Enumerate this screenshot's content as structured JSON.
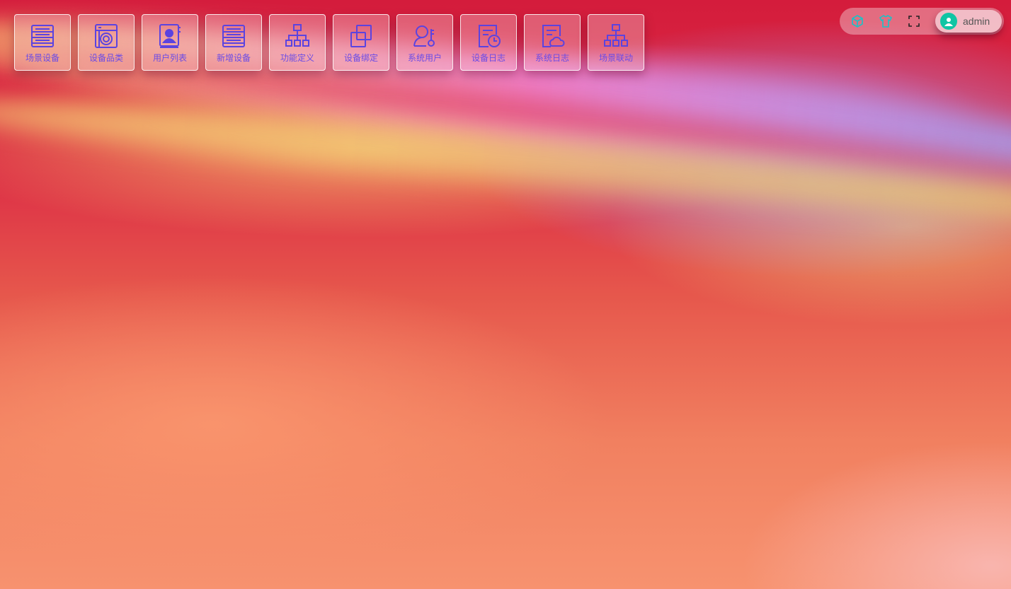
{
  "desktop": {
    "shortcuts": [
      {
        "label": "场景设备",
        "icon": "server-list-icon"
      },
      {
        "label": "设备品类",
        "icon": "washing-machine-icon"
      },
      {
        "label": "用户列表",
        "icon": "contact-book-icon"
      },
      {
        "label": "新增设备",
        "icon": "server-list-icon"
      },
      {
        "label": "功能定义",
        "icon": "org-chart-icon"
      },
      {
        "label": "设备绑定",
        "icon": "copy-squares-icon"
      },
      {
        "label": "系统用户",
        "icon": "user-key-icon"
      },
      {
        "label": "设备日志",
        "icon": "log-clock-icon"
      },
      {
        "label": "系统日志",
        "icon": "log-cloud-icon"
      },
      {
        "label": "场景联动",
        "icon": "org-chart-icon"
      }
    ]
  },
  "topbar": {
    "icons": [
      "cube-icon",
      "tshirt-icon",
      "fullscreen-icon"
    ],
    "user": {
      "name": "admin",
      "avatar": "user-avatar-icon"
    }
  },
  "colors": {
    "icon_accent": "#5b43e0",
    "topbar_icon": "#18c4c8",
    "avatar_bg": "#10c5a4"
  }
}
